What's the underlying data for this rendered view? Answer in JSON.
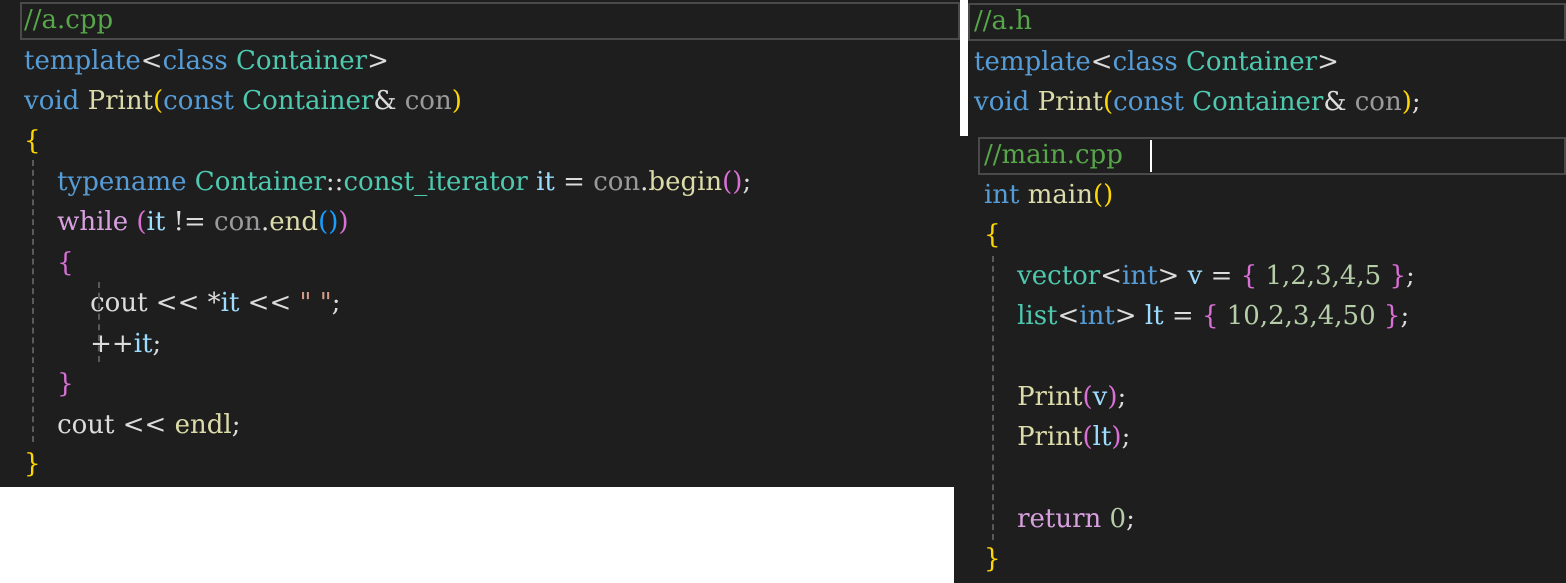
{
  "editors": {
    "a_cpp": {
      "file_comment": "//a.cpp",
      "lines": [
        "template<class Container>",
        "void Print(const Container& con)",
        "{",
        "    typename Container::const_iterator it = con.begin();",
        "    while (it != con.end())",
        "    {",
        "        cout << *it << \" \";",
        "        ++it;",
        "    }",
        "    cout << endl;",
        "}"
      ]
    },
    "a_h": {
      "file_comment": "//a.h",
      "lines": [
        "template<class Container>",
        "void Print(const Container& con);"
      ]
    },
    "main_cpp": {
      "file_comment": "//main.cpp",
      "lines": [
        "int main()",
        "{",
        "    vector<int> v = { 1,2,3,4,5 };",
        "    list<int> lt = { 10,2,3,4,50 };",
        "",
        "    Print(v);",
        "    Print(lt);",
        "",
        "    return 0;",
        "}"
      ]
    }
  },
  "tokens": {
    "template": "template",
    "lt": "<",
    "gt": ">",
    "class": "class",
    "Container": "Container",
    "void": "void",
    "Print": "Print",
    "lparen": "(",
    "rparen": ")",
    "const": "const",
    "amp_con": "& ",
    "con": "con",
    "semicolon": ";",
    "lbrace": "{",
    "rbrace": "}",
    "typename": "typename",
    "scope": "::",
    "const_iterator": "const_iterator",
    "it": "it",
    "eq": " = ",
    "dot": ".",
    "begin": "begin",
    "paren_pair": "()",
    "while": "while",
    "neq": " != ",
    "end": "end",
    "cout": "cout",
    "shl": " << ",
    "star": "*",
    "space_str": "\" \"",
    "inc": "++",
    "endl": "endl",
    "int": "int",
    "main": "main",
    "vector": "vector",
    "list": "list",
    "v": "v",
    "lt_var": "lt",
    "brace_open_sp": "{ ",
    "brace_close_sp": " }",
    "nums_v": "1,2,3,4,5",
    "nums_lt": "10,2,3,4,50",
    "return": "return",
    "zero": "0"
  },
  "colors": {
    "background": "#1e1e1e",
    "comment": "#57a64a",
    "keyword": "#569cd6",
    "control_keyword": "#d8a0df",
    "type": "#4ec9b0",
    "function": "#dcdcaa",
    "parameter": "#9a9a9a",
    "variable": "#9cdcfe",
    "number": "#b5cea8",
    "string": "#d69d85",
    "bracket_level1": "#ffd700",
    "bracket_level2": "#da70d6",
    "bracket_level3": "#179fff"
  }
}
